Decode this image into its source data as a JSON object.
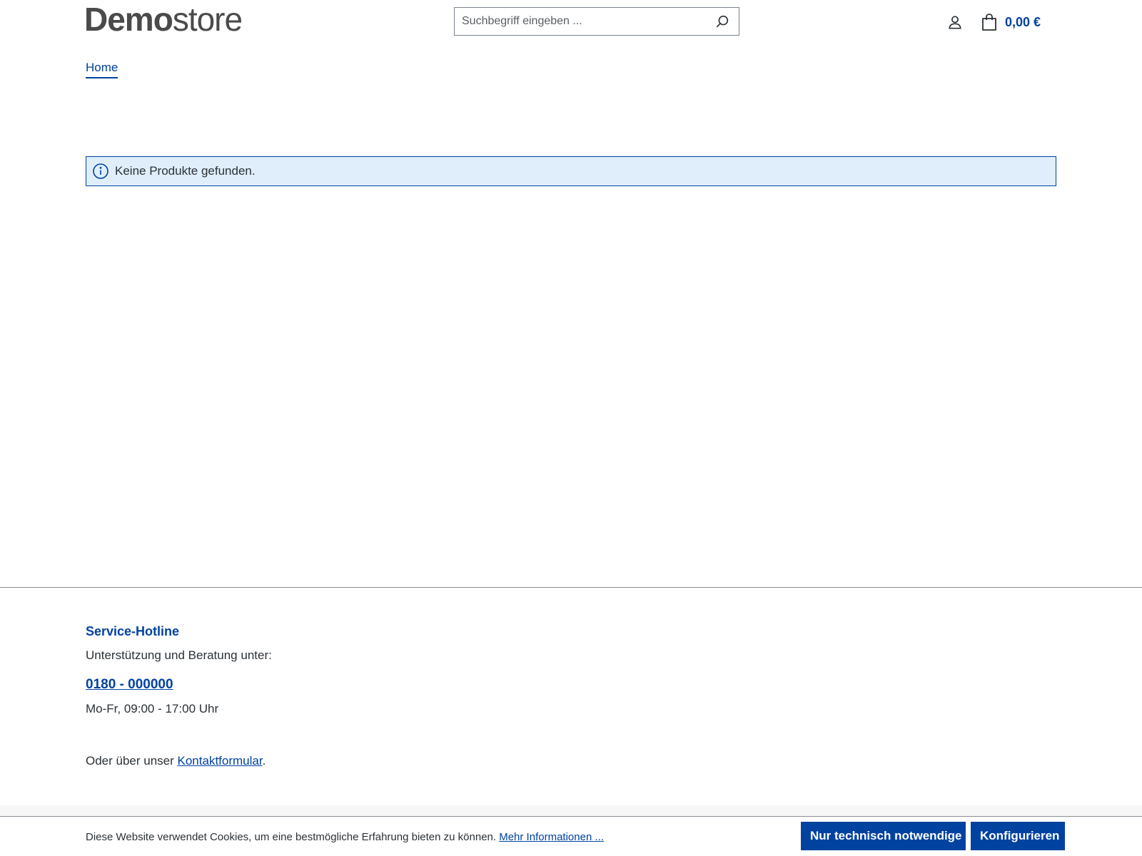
{
  "header": {
    "logo_strong": "Demo",
    "logo_light": "store",
    "search_placeholder": "Suchbegriff eingeben ...",
    "search_value": "",
    "cart_total": "0,00 €"
  },
  "breadcrumb": {
    "home": "Home"
  },
  "alert": {
    "message": "Keine Produkte gefunden."
  },
  "footer": {
    "hotline_title": "Service-Hotline",
    "hotline_desc": "Unterstützung und Beratung unter:",
    "hotline_phone": "0180 - 000000",
    "hotline_hours": "Mo-Fr, 09:00 - 17:00 Uhr",
    "contact_prefix": "Oder über unser ",
    "contact_link": "Kontaktformular",
    "contact_suffix": "."
  },
  "cookie": {
    "text": "Diese Website verwendet Cookies, um eine bestmögliche Erfahrung bieten zu können. ",
    "more_link": "Mehr Informationen ...",
    "btn_necessary": "Nur technisch notwendige",
    "btn_configure": "Konfigurieren"
  },
  "colors": {
    "primary": "#0042a0",
    "alert_bg": "#dfeefa",
    "text": "#2b3136",
    "logo": "#4a4a4a"
  },
  "icons": [
    "search-icon",
    "account-icon",
    "cart-bag-icon",
    "info-icon"
  ]
}
